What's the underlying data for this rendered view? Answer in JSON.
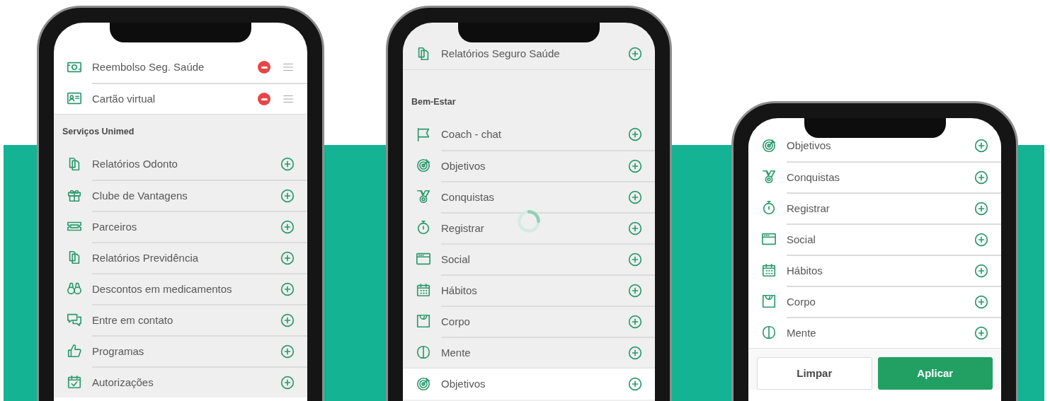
{
  "phones": [
    {
      "sections": [
        {
          "kind": "selected",
          "items": [
            {
              "label": "Reembolso Seg. Saúde",
              "kind": "removable"
            },
            {
              "label": "Cartão virtual",
              "kind": "removable"
            }
          ]
        },
        {
          "kind": "catalog",
          "heading": "Serviços Unimed",
          "items": [
            {
              "label": "Relatórios Odonto",
              "kind": "addable"
            },
            {
              "label": "Clube de Vantagens",
              "kind": "addable"
            },
            {
              "label": "Parceiros",
              "kind": "addable"
            },
            {
              "label": "Relatórios Previdência",
              "kind": "addable"
            },
            {
              "label": "Descontos em medicamentos",
              "kind": "addable"
            },
            {
              "label": "Entre em contato",
              "kind": "addable"
            },
            {
              "label": "Programas",
              "kind": "addable"
            },
            {
              "label": "Autorizações",
              "kind": "addable"
            }
          ]
        }
      ]
    },
    {
      "loading": true,
      "sections": [
        {
          "kind": "catalog",
          "items": [
            {
              "label": "Relatórios Seguro Saúde",
              "kind": "addable"
            }
          ]
        },
        {
          "kind": "catalog",
          "heading": "Bem-Estar",
          "items": [
            {
              "label": "Coach - chat",
              "kind": "addable"
            },
            {
              "label": "Objetivos",
              "kind": "addable"
            },
            {
              "label": "Conquistas",
              "kind": "addable"
            },
            {
              "label": "Registrar",
              "kind": "addable"
            },
            {
              "label": "Social",
              "kind": "addable"
            },
            {
              "label": "Hábitos",
              "kind": "addable"
            },
            {
              "label": "Corpo",
              "kind": "addable"
            },
            {
              "label": "Mente",
              "kind": "addable"
            }
          ]
        },
        {
          "kind": "selected",
          "items": [
            {
              "label": "Objetivos",
              "kind": "addable"
            }
          ]
        }
      ]
    },
    {
      "sections": [
        {
          "kind": "selected",
          "items": [
            {
              "label": "Objetivos",
              "kind": "addable"
            },
            {
              "label": "Conquistas",
              "kind": "addable"
            },
            {
              "label": "Registrar",
              "kind": "addable"
            },
            {
              "label": "Social",
              "kind": "addable"
            },
            {
              "label": "Hábitos",
              "kind": "addable"
            },
            {
              "label": "Corpo",
              "kind": "addable"
            },
            {
              "label": "Mente",
              "kind": "addable"
            }
          ]
        }
      ],
      "buttons": [
        {
          "label": "Limpar",
          "kind": "secondary"
        },
        {
          "label": "Aplicar",
          "kind": "primary"
        }
      ]
    }
  ]
}
